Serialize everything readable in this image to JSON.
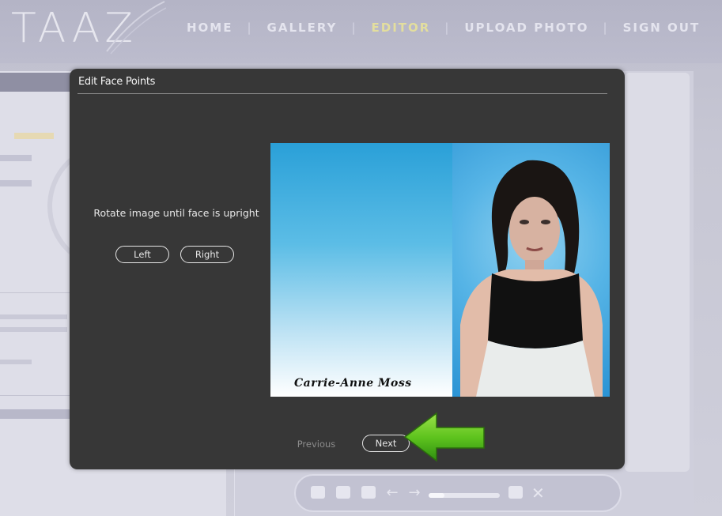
{
  "app": {
    "logo": "TAAZ",
    "nav": [
      {
        "label": "HOME"
      },
      {
        "label": "GALLERY"
      },
      {
        "label": "EDITOR",
        "active": true
      },
      {
        "label": "UPLOAD PHOTO"
      },
      {
        "label": "SIGN OUT"
      }
    ],
    "colors": {
      "nav_active": "#e3de9e",
      "modal_bg": "#373737",
      "arrow": "#5fc41e"
    }
  },
  "modal": {
    "title": "Edit Face Points",
    "instruction": "Rotate image until face is upright",
    "buttons": {
      "left": "Left",
      "right": "Right",
      "previous": "Previous",
      "next": "Next"
    },
    "photo": {
      "caption": "Carrie-Anne Moss"
    }
  },
  "icons": {
    "hint_arrow": "green-left-arrow-icon"
  }
}
